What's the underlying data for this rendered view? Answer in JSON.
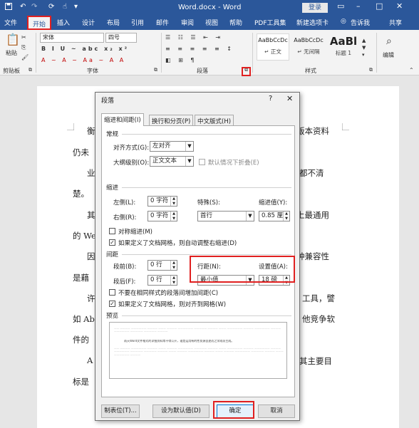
{
  "window": {
    "title": "Word.docx - Word",
    "login": "登录",
    "qat_icons": [
      "save-icon",
      "undo-icon",
      "redo-icon",
      "sync-icon",
      "touch-icon"
    ]
  },
  "tabs": [
    {
      "label": "文件"
    },
    {
      "label": "开始"
    },
    {
      "label": "插入"
    },
    {
      "label": "设计"
    },
    {
      "label": "布局"
    },
    {
      "label": "引用"
    },
    {
      "label": "邮件"
    },
    {
      "label": "审阅"
    },
    {
      "label": "视图"
    },
    {
      "label": "帮助"
    },
    {
      "label": "PDF工具集"
    },
    {
      "label": "新建选项卡"
    }
  ],
  "tell_me": "告诉我",
  "share": "共享",
  "ribbon": {
    "paste": "粘贴",
    "clipboard": "剪贴板",
    "font_name": "宋体",
    "font_size": "四号",
    "font_group": "字体",
    "paragraph_group": "段落",
    "styles_group": "样式",
    "edit_group": "编辑",
    "format_row1": "B I U ~ abc x₂ x²",
    "format_row2": "A ~ A ~ Aa ~ A A",
    "styles": [
      {
        "sample": "AaBbCcDc",
        "name": "正文",
        "prefix": "↵"
      },
      {
        "sample": "AaBbCcDc",
        "name": "无间隔",
        "prefix": "↵"
      },
      {
        "sample": "AaBl",
        "name": "标题 1",
        "prefix": ""
      }
    ]
  },
  "document": {
    "lines": [
      "衡",
      "版本资料",
      "仍未",
      "业",
      "都不清",
      "楚。",
      "其",
      "上最通用",
      "的 We",
      "因",
      "种兼容性",
      "是藉",
      "许",
      "工具，譬",
      "如 Ab",
      "他竞争软",
      "件的",
      "A",
      "其主要目",
      "标是"
    ]
  },
  "dialog": {
    "title": "段落",
    "help": "?",
    "tabs": [
      {
        "label": "缩进和间距(I)"
      },
      {
        "label": "换行和分页(P)"
      },
      {
        "label": "中文版式(H)"
      }
    ],
    "general": {
      "heading": "常规",
      "alignment_label": "对齐方式(G):",
      "alignment_value": "左对齐",
      "outline_label": "大纲级别(O):",
      "outline_value": "正文文本",
      "collapsed_label": "默认情况下折叠(E)"
    },
    "indent": {
      "heading": "缩进",
      "left_label": "左侧(L):",
      "left_value": "0 字符",
      "right_label": "右侧(R):",
      "right_value": "0 字符",
      "special_label": "特殊(S):",
      "special_value": "首行",
      "by_label": "缩进值(Y):",
      "by_value": "0.85 厘",
      "mirror_label": "对称缩进(M)",
      "grid_label": "如果定义了文档网格，则自动调整右缩进(D)"
    },
    "spacing": {
      "heading": "间距",
      "before_label": "段前(B):",
      "before_value": "0 行",
      "after_label": "段后(F):",
      "after_value": "0 行",
      "line_label": "行距(N):",
      "line_value": "最小值",
      "at_label": "设置值(A):",
      "at_value": "18 磅",
      "no_space_label": "不要在相同样式的段落间增加间距(C)",
      "snap_label": "如果定义了文档网格，则对齐到网格(W)"
    },
    "preview": {
      "heading": "预览",
      "sample_text": "雨天Word文件格式的详细资料常不得公开，谁是运用有的性发源自述而之学成派主成。"
    },
    "buttons": {
      "tabs": "制表位(T)...",
      "default": "设为默认值(D)",
      "ok": "确定",
      "cancel": "取消"
    }
  }
}
